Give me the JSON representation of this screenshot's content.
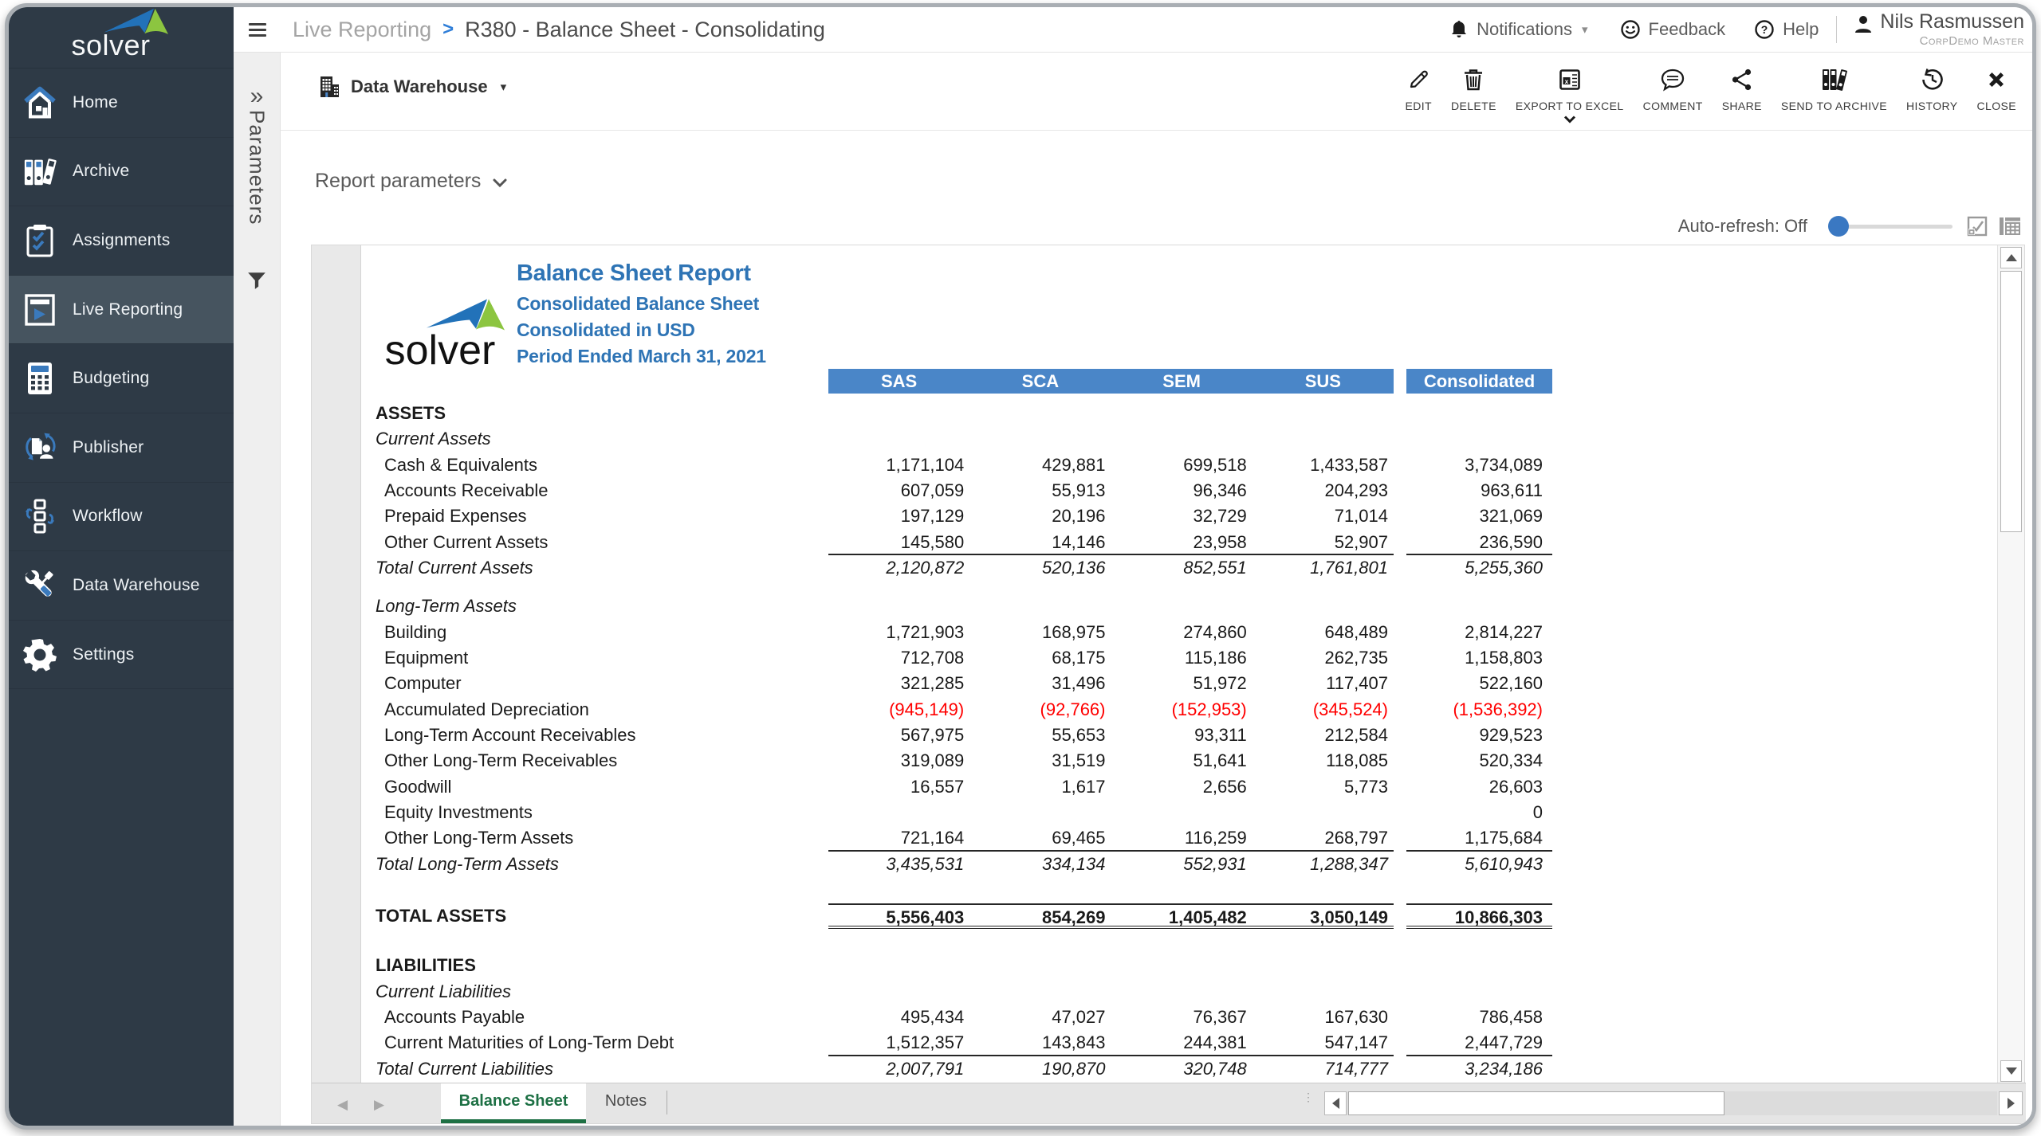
{
  "colors": {
    "sidebar_bg": "#2e3a46",
    "sidebar_active_bg": "#46545f",
    "accent_blue": "#2f7ed8",
    "logo_blue": "#2272b9",
    "logo_green": "#8cc540",
    "report_title_blue": "#2e74b5",
    "table_header_blue": "#4a86c8",
    "negative_red": "#ff0000",
    "active_tab_green": "#1d7044",
    "slider_knob_blue": "#3a78c2"
  },
  "sidebar": {
    "logo_text": "solver",
    "items": [
      {
        "icon": "home",
        "label": "Home",
        "active": false
      },
      {
        "icon": "archive",
        "label": "Archive",
        "active": false
      },
      {
        "icon": "assignments",
        "label": "Assignments",
        "active": false
      },
      {
        "icon": "live-reporting",
        "label": "Live Reporting",
        "active": true
      },
      {
        "icon": "budgeting",
        "label": "Budgeting",
        "active": false
      },
      {
        "icon": "publisher",
        "label": "Publisher",
        "active": false
      },
      {
        "icon": "workflow",
        "label": "Workflow",
        "active": false
      },
      {
        "icon": "data-warehouse",
        "label": "Data Warehouse",
        "active": false
      },
      {
        "icon": "settings",
        "label": "Settings",
        "active": false
      }
    ]
  },
  "parameters_rail": {
    "expand_glyph": "»",
    "label": "Parameters"
  },
  "topbar": {
    "breadcrumb": {
      "section": "Live Reporting",
      "separator": ">",
      "page": "R380 - Balance Sheet - Consolidating"
    },
    "notifications_label": "Notifications",
    "feedback_label": "Feedback",
    "help_label": "Help",
    "user": {
      "name": "Nils Rasmussen",
      "org": "CorpDemo Master"
    }
  },
  "toolbar": {
    "source_label": "Data Warehouse",
    "actions": [
      {
        "icon": "edit",
        "label": "EDIT",
        "menu": false
      },
      {
        "icon": "delete",
        "label": "DELETE",
        "menu": false
      },
      {
        "icon": "export-excel",
        "label": "EXPORT TO EXCEL",
        "menu": true
      },
      {
        "icon": "comment",
        "label": "COMMENT",
        "menu": false
      },
      {
        "icon": "share",
        "label": "SHARE",
        "menu": false
      },
      {
        "icon": "send-archive",
        "label": "SEND TO ARCHIVE",
        "menu": false
      },
      {
        "icon": "history",
        "label": "HISTORY",
        "menu": false
      },
      {
        "icon": "close",
        "label": "CLOSE",
        "menu": false
      }
    ]
  },
  "report_parameters_label": "Report parameters",
  "auto_refresh_label": "Auto-refresh: Off",
  "report": {
    "logo_text": "solver",
    "title": "Balance Sheet Report",
    "subtitle1": "Consolidated Balance Sheet",
    "subtitle2": "Consolidated in USD",
    "subtitle3": "Period Ended March 31, 2021",
    "columns": [
      "SAS",
      "SCA",
      "SEM",
      "SUS"
    ],
    "consolidated_column": "Consolidated",
    "rows": [
      {
        "type": "section",
        "label": "ASSETS"
      },
      {
        "type": "subsection",
        "label": "Current Assets"
      },
      {
        "type": "item",
        "label": "Cash & Equivalents",
        "values": [
          "1,171,104",
          "429,881",
          "699,518",
          "1,433,587"
        ],
        "consolidated": "3,734,089"
      },
      {
        "type": "item",
        "label": "Accounts Receivable",
        "values": [
          "607,059",
          "55,913",
          "96,346",
          "204,293"
        ],
        "consolidated": "963,611"
      },
      {
        "type": "item",
        "label": "Prepaid Expenses",
        "values": [
          "197,129",
          "20,196",
          "32,729",
          "71,014"
        ],
        "consolidated": "321,069"
      },
      {
        "type": "item",
        "label": "Other Current Assets",
        "values": [
          "145,580",
          "14,146",
          "23,958",
          "52,907"
        ],
        "consolidated": "236,590",
        "line_below": true
      },
      {
        "type": "total",
        "label": "Total Current Assets",
        "values": [
          "2,120,872",
          "520,136",
          "852,551",
          "1,761,801"
        ],
        "consolidated": "5,255,360"
      },
      {
        "type": "spacer",
        "height": 16
      },
      {
        "type": "subsection",
        "label": "Long-Term Assets"
      },
      {
        "type": "item",
        "label": "Building",
        "values": [
          "1,721,903",
          "168,975",
          "274,860",
          "648,489"
        ],
        "consolidated": "2,814,227"
      },
      {
        "type": "item",
        "label": "Equipment",
        "values": [
          "712,708",
          "68,175",
          "115,186",
          "262,735"
        ],
        "consolidated": "1,158,803"
      },
      {
        "type": "item",
        "label": "Computer",
        "values": [
          "321,285",
          "31,496",
          "51,972",
          "117,407"
        ],
        "consolidated": "522,160"
      },
      {
        "type": "item",
        "label": "Accumulated Depreciation",
        "values": [
          "(945,149)",
          "(92,766)",
          "(152,953)",
          "(345,524)"
        ],
        "consolidated": "(1,536,392)",
        "negative": true
      },
      {
        "type": "item",
        "label": "Long-Term Account Receivables",
        "values": [
          "567,975",
          "55,653",
          "93,311",
          "212,584"
        ],
        "consolidated": "929,523"
      },
      {
        "type": "item",
        "label": "Other Long-Term Receivables",
        "values": [
          "319,089",
          "31,519",
          "51,641",
          "118,085"
        ],
        "consolidated": "520,334"
      },
      {
        "type": "item",
        "label": "Goodwill",
        "values": [
          "16,557",
          "1,617",
          "2,656",
          "5,773"
        ],
        "consolidated": "26,603"
      },
      {
        "type": "item",
        "label": "Equity Investments",
        "values": [
          "",
          "",
          "",
          ""
        ],
        "consolidated": "0"
      },
      {
        "type": "item",
        "label": "Other Long-Term Assets",
        "values": [
          "721,164",
          "69,465",
          "116,259",
          "268,797"
        ],
        "consolidated": "1,175,684",
        "line_below": true
      },
      {
        "type": "total",
        "label": "Total Long-Term Assets",
        "values": [
          "3,435,531",
          "334,134",
          "552,931",
          "1,288,347"
        ],
        "consolidated": "5,610,943"
      },
      {
        "type": "spacer",
        "height": 33
      },
      {
        "type": "grand",
        "label": "TOTAL ASSETS",
        "values": [
          "5,556,403",
          "854,269",
          "1,405,482",
          "3,050,149"
        ],
        "consolidated": "10,866,303",
        "line_above": true,
        "double_below": true
      },
      {
        "type": "spacer",
        "height": 30
      },
      {
        "type": "section",
        "label": "LIABILITIES"
      },
      {
        "type": "subsection",
        "label": "Current Liabilities"
      },
      {
        "type": "item",
        "label": "Accounts Payable",
        "values": [
          "495,434",
          "47,027",
          "76,367",
          "167,630"
        ],
        "consolidated": "786,458"
      },
      {
        "type": "item",
        "label": "Current Maturities of Long-Term Debt",
        "values": [
          "1,512,357",
          "143,843",
          "244,381",
          "547,147"
        ],
        "consolidated": "2,447,729",
        "line_below": true
      },
      {
        "type": "total",
        "label": "Total Current Liabilities",
        "values": [
          "2,007,791",
          "190,870",
          "320,748",
          "714,777"
        ],
        "consolidated": "3,234,186"
      }
    ]
  },
  "sheet_tabs": [
    {
      "label": "Balance Sheet",
      "active": true
    },
    {
      "label": "Notes",
      "active": false
    }
  ]
}
